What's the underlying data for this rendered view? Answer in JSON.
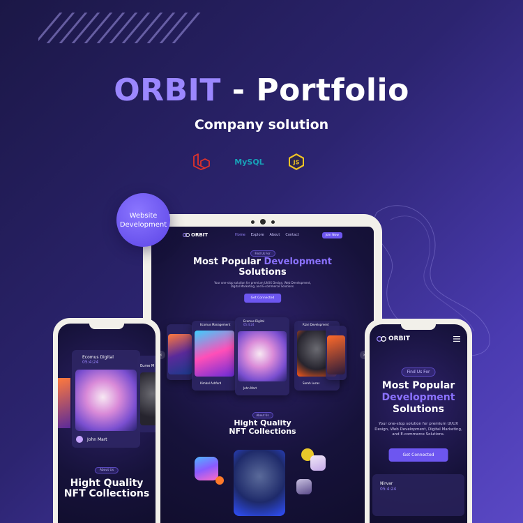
{
  "headline": {
    "brand": "ORBIT",
    "rest": " - Portfolio"
  },
  "subtitle": "Company solution",
  "techs": [
    {
      "name": "laravel-icon",
      "color": "#e0322b"
    },
    {
      "name": "mysql-icon",
      "label": "MySQL",
      "color": "#17a2b8"
    },
    {
      "name": "nodejs-icon",
      "label": "JS",
      "color": "#f0c325"
    }
  ],
  "badge": {
    "line1": "Website",
    "line2": "Development"
  },
  "tablet": {
    "logo": "ORBIT",
    "nav": [
      "Home",
      "Explore",
      "About",
      "Contact"
    ],
    "join": "Join Now",
    "hero_pill": "Find Us For",
    "hero_line1": "Most Popular ",
    "hero_accent": "Development",
    "hero_line2": "Solutions",
    "desc1": "Your one-stop solution for premium UI/UX Design, Web Development,",
    "desc2": "Digital Marketing, and E-commerce Solutions.",
    "cta": "Get Connected",
    "cards": [
      {
        "title": "Ecomus Management",
        "author": "Kimbal Ashford"
      },
      {
        "title": "Ecomus Digital",
        "code": "05:4:24",
        "author": "John Mart"
      },
      {
        "title": "Rizvi Development",
        "author": "Sarah Lucas"
      }
    ],
    "nft_pill": "About Us",
    "nft_line1": "Hight Quality",
    "nft_line2": "NFT Collections"
  },
  "phone_left": {
    "card_title": "Ecomus Digital",
    "card_code": "05:4:24",
    "card_author": "John Mart",
    "side_label": "Eume M",
    "pill": "About Us",
    "nft_line1": "Hight Quality",
    "nft_line2": "NFT Collections"
  },
  "phone_right": {
    "logo": "ORBIT",
    "pill": "Find Us For",
    "hero_line1": "Most Popular",
    "hero_accent": "Development",
    "hero_line2": "Solutions",
    "desc": "Your one-stop solution for premium UI/UX Design, Web Development, Digital Marketing, and E-commerce Solutions.",
    "cta": "Get Connected",
    "bottom_name": "Nirvar",
    "bottom_code": "05:4:24"
  }
}
